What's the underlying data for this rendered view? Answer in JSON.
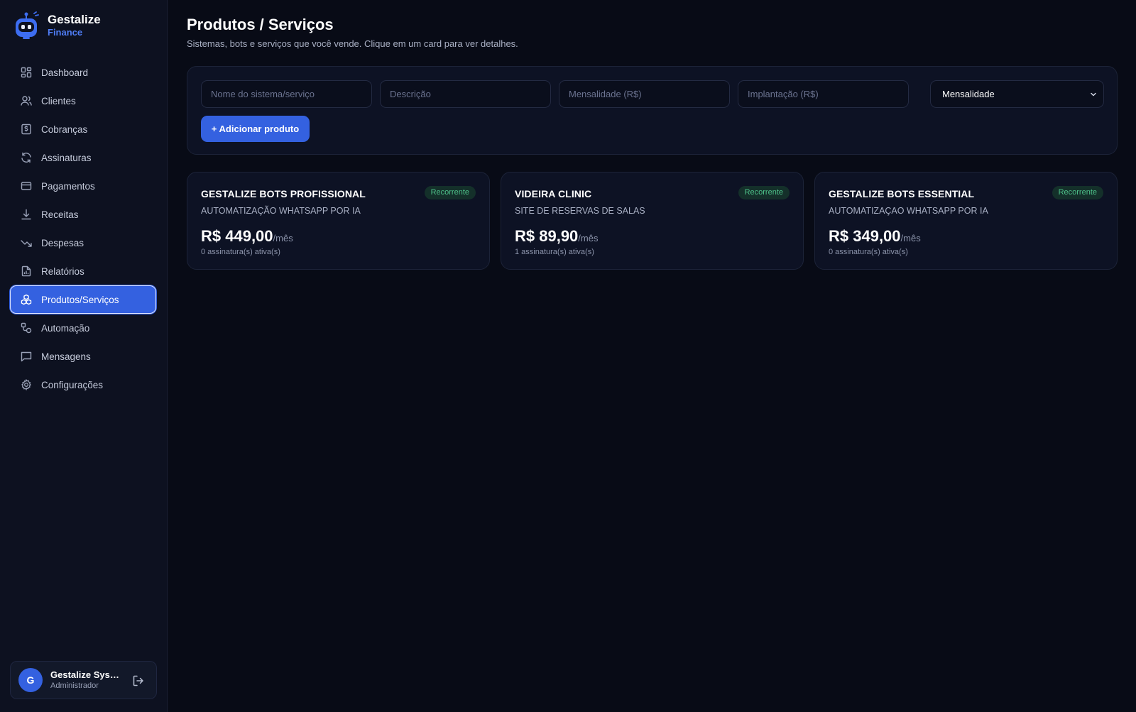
{
  "brand": {
    "name": "Gestalize",
    "sub": "Finance"
  },
  "sidebar": {
    "items": [
      {
        "label": "Dashboard",
        "icon": "dashboard-icon"
      },
      {
        "label": "Clientes",
        "icon": "users-icon"
      },
      {
        "label": "Cobranças",
        "icon": "invoice-dollar-icon"
      },
      {
        "label": "Assinaturas",
        "icon": "refresh-icon"
      },
      {
        "label": "Pagamentos",
        "icon": "credit-card-icon"
      },
      {
        "label": "Receitas",
        "icon": "download-icon"
      },
      {
        "label": "Despesas",
        "icon": "trending-down-icon"
      },
      {
        "label": "Relatórios",
        "icon": "report-icon"
      },
      {
        "label": "Produtos/Serviços",
        "icon": "boxes-icon",
        "active": true
      },
      {
        "label": "Automação",
        "icon": "workflow-icon"
      },
      {
        "label": "Mensagens",
        "icon": "chat-icon"
      },
      {
        "label": "Configurações",
        "icon": "gear-icon"
      }
    ]
  },
  "user": {
    "initial": "G",
    "name": "Gestalize Systems",
    "role": "Administrador"
  },
  "page": {
    "title": "Produtos / Serviços",
    "subtitle": "Sistemas, bots e serviços que você vende. Clique em um card para ver detalhes."
  },
  "form": {
    "name_placeholder": "Nome do sistema/serviço",
    "desc_placeholder": "Descrição",
    "monthly_placeholder": "Mensalidade (R$)",
    "setup_placeholder": "Implantação (R$)",
    "billing_type": "Mensalidade",
    "add_label": "+ Adicionar produto"
  },
  "products": [
    {
      "title": "GESTALIZE BOTS PROFISSIONAL",
      "badge": "Recorrente",
      "description": "AUTOMATIZAÇÃO WHATSAPP POR IA",
      "price": "R$ 449,00",
      "unit": "/mês",
      "subscriptions": "0 assinatura(s) ativa(s)"
    },
    {
      "title": "VIDEIRA CLINIC",
      "badge": "Recorrente",
      "description": "SITE DE RESERVAS DE SALAS",
      "price": "R$ 89,90",
      "unit": "/mês",
      "subscriptions": "1 assinatura(s) ativa(s)"
    },
    {
      "title": "GESTALIZE BOTS ESSENTIAL",
      "badge": "Recorrente",
      "description": "AUTOMATIZAÇAO WHATSAPP POR IA",
      "price": "R$ 349,00",
      "unit": "/mês",
      "subscriptions": "0 assinatura(s) ativa(s)"
    }
  ],
  "colors": {
    "accent": "#3461e0",
    "background": "#080b16",
    "badge_text": "#4ec28a"
  }
}
